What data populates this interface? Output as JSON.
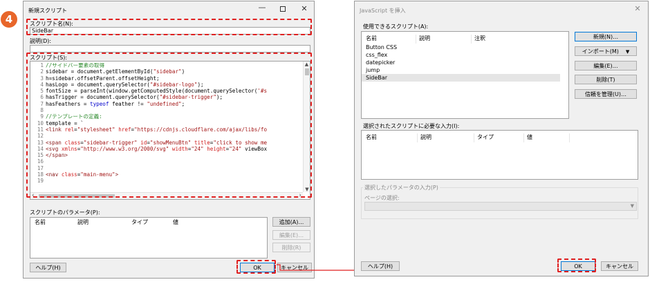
{
  "badge": "4",
  "left": {
    "title": "新規スクリプト",
    "name_label": "スクリプト名(N):",
    "name_value": "SideBar",
    "desc_label": "説明(D):",
    "script_label": "スクリプト(S):",
    "code": [
      {
        "n": "1",
        "parts": [
          [
            "cm",
            "//サイドバー要素の取得"
          ]
        ]
      },
      {
        "n": "2",
        "parts": [
          [
            "",
            "sidebar = document.getElementById("
          ],
          [
            "st",
            "\"sidebar\""
          ],
          [
            "",
            ")"
          ]
        ]
      },
      {
        "n": "3",
        "parts": [
          [
            "",
            "h=sidebar.offsetParent.offsetHeight;"
          ]
        ]
      },
      {
        "n": "4",
        "parts": [
          [
            "",
            "hasLogo = document.querySelector("
          ],
          [
            "st",
            "\"#sidebar-logo\""
          ],
          [
            "",
            ");"
          ]
        ]
      },
      {
        "n": "5",
        "parts": [
          [
            "",
            "fontSize = parseInt(window.getComputedStyle(document.querySelector("
          ],
          [
            "st",
            "'#s"
          ]
        ]
      },
      {
        "n": "6",
        "parts": [
          [
            "",
            "hasTrigger = document.querySelector("
          ],
          [
            "st",
            "\"#sidebar-trigger\""
          ],
          [
            "",
            ");"
          ]
        ]
      },
      {
        "n": "7",
        "parts": [
          [
            "",
            "hasFeathers = "
          ],
          [
            "kw",
            "typeof"
          ],
          [
            "",
            " feather != "
          ],
          [
            "st",
            "\"undefined\""
          ],
          [
            "",
            ";"
          ]
        ]
      },
      {
        "n": "8",
        "parts": []
      },
      {
        "n": "9",
        "parts": [
          [
            "cm",
            "//テンプレートの定義:"
          ]
        ]
      },
      {
        "n": "10",
        "parts": [
          [
            "",
            "template = `"
          ]
        ]
      },
      {
        "n": "11",
        "parts": [
          [
            "tg",
            "<link "
          ],
          [
            "at",
            "rel"
          ],
          [
            "",
            "="
          ],
          [
            "st",
            "\"stylesheet\""
          ],
          [
            "",
            " "
          ],
          [
            "at",
            "href"
          ],
          [
            "",
            "="
          ],
          [
            "st",
            "\"https://cdnjs.cloudflare.com/ajax/libs/fo"
          ]
        ]
      },
      {
        "n": "12",
        "parts": []
      },
      {
        "n": "13",
        "parts": [
          [
            "tg",
            "<span "
          ],
          [
            "at",
            "class"
          ],
          [
            "",
            "="
          ],
          [
            "st",
            "\"sidebar-trigger\""
          ],
          [
            "",
            " "
          ],
          [
            "at",
            "id"
          ],
          [
            "",
            "="
          ],
          [
            "st",
            "\"showMenuBtn\""
          ],
          [
            "",
            " "
          ],
          [
            "at",
            "title"
          ],
          [
            "",
            "="
          ],
          [
            "st",
            "\"click to show me"
          ]
        ]
      },
      {
        "n": "14",
        "parts": [
          [
            "tg",
            "<svg "
          ],
          [
            "at",
            "xmlns"
          ],
          [
            "",
            "="
          ],
          [
            "st",
            "\"http://www.w3.org/2000/svg\""
          ],
          [
            "",
            " "
          ],
          [
            "at",
            "width"
          ],
          [
            "",
            "="
          ],
          [
            "st",
            "\"24\""
          ],
          [
            "",
            " "
          ],
          [
            "at",
            "height"
          ],
          [
            "",
            "="
          ],
          [
            "st",
            "\"24\""
          ],
          [
            "",
            " viewBox"
          ]
        ]
      },
      {
        "n": "15",
        "parts": [
          [
            "tg",
            "</span>"
          ]
        ]
      },
      {
        "n": "16",
        "parts": []
      },
      {
        "n": "17",
        "parts": []
      },
      {
        "n": "18",
        "parts": [
          [
            "tg",
            "<nav "
          ],
          [
            "at",
            "class"
          ],
          [
            "",
            "="
          ],
          [
            "st",
            "\"main-menu\""
          ],
          [
            "tg",
            ">"
          ]
        ]
      },
      {
        "n": "19",
        "parts": []
      }
    ],
    "params_label": "スクリプトのパラメータ(P):",
    "params_cols": [
      "名前",
      "説明",
      "タイプ",
      "値"
    ],
    "btn_add": "追加(A)…",
    "btn_edit": "編集(E)…",
    "btn_delete": "削除(R)",
    "btn_help": "ヘルプ(H)",
    "btn_ok": "OK",
    "btn_cancel": "キャンセル"
  },
  "right": {
    "title": "JavaScript を挿入",
    "avail_label": "使用できるスクリプト(A):",
    "avail_cols": [
      "名前",
      "説明",
      "注釈"
    ],
    "scripts": [
      "Button CSS",
      "css_flex",
      "datepicker",
      "jump",
      "SideBar"
    ],
    "btn_new": "新規(N)…",
    "btn_import": "インポート(M)",
    "btn_edit": "編集(E)…",
    "btn_delete": "削除(T)",
    "btn_trust": "信頼を管理(U)…",
    "inputs_label": "選択されたスクリプトに必要な入力(I):",
    "inputs_cols": [
      "名前",
      "説明",
      "タイプ",
      "値"
    ],
    "param_group": "選択したパラメータの入力(P)",
    "page_select_label": "ページの選択:",
    "btn_help": "ヘルプ(H)",
    "btn_ok": "OK",
    "btn_cancel": "キャンセル"
  },
  "colors": {
    "accent": "#e02020",
    "badge": "#e8662a",
    "selection": "#e5e5e5"
  }
}
